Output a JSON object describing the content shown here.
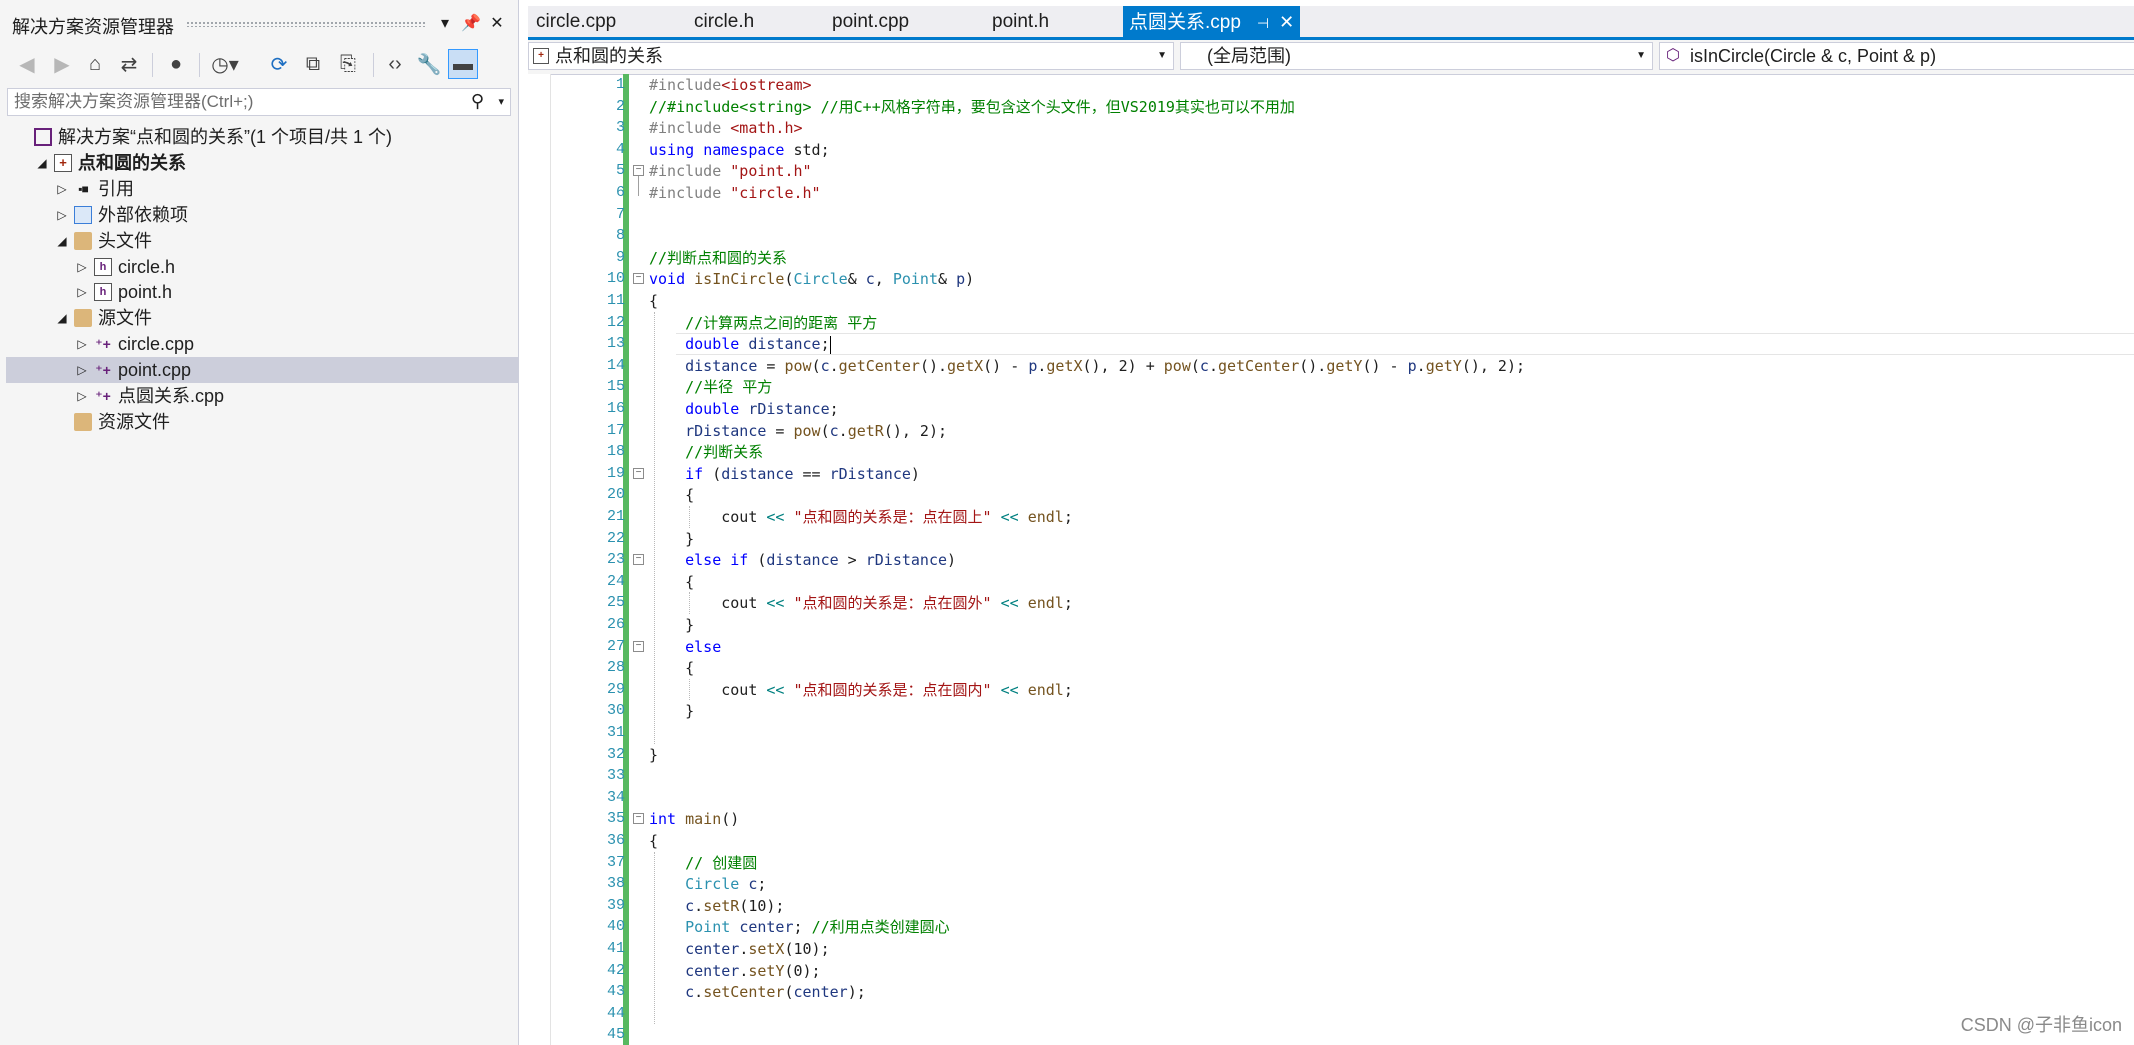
{
  "solution_explorer": {
    "title": "解决方案资源管理器",
    "title_buttons": [
      "dropdown-icon",
      "pin-icon",
      "close-icon"
    ],
    "toolbar_icons": [
      "back-icon",
      "forward-icon",
      "home-icon",
      "switch-views-icon",
      "globe-icon",
      "history-icon",
      "sync-icon",
      "collapse-all-icon",
      "show-all-files-icon",
      "view-code-icon",
      "properties-icon",
      "preview-icon"
    ],
    "search_placeholder": "搜索解决方案资源管理器(Ctrl+;)",
    "tree": [
      {
        "label": "解决方案“点和圆的关系”(1 个项目/共 1 个)",
        "icon": "solution-icon",
        "level": 0,
        "expander": ""
      },
      {
        "label": "点和圆的关系",
        "icon": "project-icon",
        "level": 1,
        "expander": "expanded",
        "bold": true
      },
      {
        "label": "引用",
        "icon": "references-icon",
        "level": 2,
        "expander": "collapsed"
      },
      {
        "label": "外部依赖项",
        "icon": "external-deps-icon",
        "level": 2,
        "expander": "collapsed"
      },
      {
        "label": "头文件",
        "icon": "folder-icon",
        "level": 2,
        "expander": "expanded"
      },
      {
        "label": "circle.h",
        "icon": "header-file-icon",
        "level": 3,
        "expander": "collapsed"
      },
      {
        "label": "point.h",
        "icon": "header-file-icon",
        "level": 3,
        "expander": "collapsed"
      },
      {
        "label": "源文件",
        "icon": "folder-icon",
        "level": 2,
        "expander": "expanded"
      },
      {
        "label": "circle.cpp",
        "icon": "cpp-file-icon",
        "level": 3,
        "expander": "collapsed"
      },
      {
        "label": "point.cpp",
        "icon": "cpp-file-icon",
        "level": 3,
        "expander": "collapsed",
        "selected": true
      },
      {
        "label": "点圆关系.cpp",
        "icon": "cpp-file-icon",
        "level": 3,
        "expander": "collapsed"
      },
      {
        "label": "资源文件",
        "icon": "folder-icon",
        "level": 2,
        "expander": ""
      }
    ]
  },
  "editor": {
    "tabs": [
      {
        "label": "circle.cpp"
      },
      {
        "label": "circle.h"
      },
      {
        "label": "point.cpp"
      },
      {
        "label": "point.h"
      },
      {
        "label": "点圆关系.cpp",
        "active": true
      }
    ],
    "nav": {
      "project": "点和圆的关系",
      "scope": "(全局范围)",
      "member": "isInCircle(Circle & c, Point & p)"
    },
    "current_line": 13,
    "lines": [
      {
        "n": 1,
        "fold": "",
        "tokens": [
          [
            "p",
            "#include"
          ],
          [
            "s",
            "<iostream>"
          ]
        ]
      },
      {
        "n": 2,
        "fold": "",
        "tokens": [
          [
            "c",
            "//#include<string> //用C++风格字符串，要包含这个头文件，但VS2019其实也可以不用加"
          ]
        ]
      },
      {
        "n": 3,
        "fold": "",
        "tokens": [
          [
            "p",
            "#include "
          ],
          [
            "s",
            "<math.h>"
          ]
        ]
      },
      {
        "n": 4,
        "fold": "",
        "tokens": [
          [
            "k",
            "using"
          ],
          [
            "",
            " "
          ],
          [
            "k",
            "namespace"
          ],
          [
            "",
            " std;"
          ]
        ]
      },
      {
        "n": 5,
        "fold": "minus",
        "tokens": [
          [
            "p",
            "#include "
          ],
          [
            "s",
            "\"point.h\""
          ]
        ]
      },
      {
        "n": 6,
        "fold": "",
        "tokens": [
          [
            "p",
            "#include "
          ],
          [
            "s",
            "\"circle.h\""
          ]
        ]
      },
      {
        "n": 7,
        "fold": "",
        "tokens": []
      },
      {
        "n": 8,
        "fold": "",
        "tokens": []
      },
      {
        "n": 9,
        "fold": "",
        "tokens": [
          [
            "c",
            "//判断点和圆的关系"
          ]
        ]
      },
      {
        "n": 10,
        "fold": "minus",
        "tokens": [
          [
            "k",
            "void"
          ],
          [
            "",
            " "
          ],
          [
            "f",
            "isInCircle"
          ],
          [
            "",
            "("
          ],
          [
            "t",
            "Circle"
          ],
          [
            "",
            "& "
          ],
          [
            "v",
            "c"
          ],
          [
            "",
            ", "
          ],
          [
            "t",
            "Point"
          ],
          [
            "",
            "& "
          ],
          [
            "v",
            "p"
          ],
          [
            "",
            ")"
          ]
        ]
      },
      {
        "n": 11,
        "fold": "",
        "tokens": [
          [
            "",
            "{"
          ]
        ]
      },
      {
        "n": 12,
        "fold": "",
        "tokens": [
          [
            "",
            "    "
          ],
          [
            "c",
            "//计算两点之间的距离 平方"
          ]
        ]
      },
      {
        "n": 13,
        "fold": "",
        "tokens": [
          [
            "",
            "    "
          ],
          [
            "k",
            "double"
          ],
          [
            "",
            " "
          ],
          [
            "v",
            "distance"
          ],
          [
            "",
            ";"
          ]
        ]
      },
      {
        "n": 14,
        "fold": "",
        "tokens": [
          [
            "",
            "    "
          ],
          [
            "v",
            "distance"
          ],
          [
            "",
            " = "
          ],
          [
            "f",
            "pow"
          ],
          [
            "",
            "("
          ],
          [
            "v",
            "c"
          ],
          [
            "",
            "."
          ],
          [
            "f",
            "getCenter"
          ],
          [
            "",
            "()."
          ],
          [
            "f",
            "getX"
          ],
          [
            "",
            "() - "
          ],
          [
            "v",
            "p"
          ],
          [
            "",
            "."
          ],
          [
            "f",
            "getX"
          ],
          [
            "",
            "(), 2) + "
          ],
          [
            "f",
            "pow"
          ],
          [
            "",
            "("
          ],
          [
            "v",
            "c"
          ],
          [
            "",
            "."
          ],
          [
            "f",
            "getCenter"
          ],
          [
            "",
            "()."
          ],
          [
            "f",
            "getY"
          ],
          [
            "",
            "() - "
          ],
          [
            "v",
            "p"
          ],
          [
            "",
            "."
          ],
          [
            "f",
            "getY"
          ],
          [
            "",
            "(), 2);"
          ]
        ]
      },
      {
        "n": 15,
        "fold": "",
        "tokens": [
          [
            "",
            "    "
          ],
          [
            "c",
            "//半径 平方"
          ]
        ]
      },
      {
        "n": 16,
        "fold": "",
        "tokens": [
          [
            "",
            "    "
          ],
          [
            "k",
            "double"
          ],
          [
            "",
            " "
          ],
          [
            "v",
            "rDistance"
          ],
          [
            "",
            ";"
          ]
        ]
      },
      {
        "n": 17,
        "fold": "",
        "tokens": [
          [
            "",
            "    "
          ],
          [
            "v",
            "rDistance"
          ],
          [
            "",
            " = "
          ],
          [
            "f",
            "pow"
          ],
          [
            "",
            "("
          ],
          [
            "v",
            "c"
          ],
          [
            "",
            "."
          ],
          [
            "f",
            "getR"
          ],
          [
            "",
            "(), 2);"
          ]
        ]
      },
      {
        "n": 18,
        "fold": "",
        "tokens": [
          [
            "",
            "    "
          ],
          [
            "c",
            "//判断关系"
          ]
        ]
      },
      {
        "n": 19,
        "fold": "minus",
        "tokens": [
          [
            "",
            "    "
          ],
          [
            "k",
            "if"
          ],
          [
            "",
            " ("
          ],
          [
            "v",
            "distance"
          ],
          [
            "",
            " == "
          ],
          [
            "v",
            "rDistance"
          ],
          [
            "",
            ")"
          ]
        ]
      },
      {
        "n": 20,
        "fold": "",
        "tokens": [
          [
            "",
            "    {"
          ]
        ]
      },
      {
        "n": 21,
        "fold": "",
        "tokens": [
          [
            "",
            "        cout "
          ],
          [
            "o",
            "<<"
          ],
          [
            "",
            " "
          ],
          [
            "s",
            "\"点和圆的关系是：点在圆上\""
          ],
          [
            "",
            " "
          ],
          [
            "o",
            "<<"
          ],
          [
            "",
            " "
          ],
          [
            "f",
            "endl"
          ],
          [
            "",
            ";"
          ]
        ]
      },
      {
        "n": 22,
        "fold": "",
        "tokens": [
          [
            "",
            "    }"
          ]
        ]
      },
      {
        "n": 23,
        "fold": "minus",
        "tokens": [
          [
            "",
            "    "
          ],
          [
            "k",
            "else if"
          ],
          [
            "",
            " ("
          ],
          [
            "v",
            "distance"
          ],
          [
            "",
            " > "
          ],
          [
            "v",
            "rDistance"
          ],
          [
            "",
            ")"
          ]
        ]
      },
      {
        "n": 24,
        "fold": "",
        "tokens": [
          [
            "",
            "    {"
          ]
        ]
      },
      {
        "n": 25,
        "fold": "",
        "tokens": [
          [
            "",
            "        cout "
          ],
          [
            "o",
            "<<"
          ],
          [
            "",
            " "
          ],
          [
            "s",
            "\"点和圆的关系是：点在圆外\""
          ],
          [
            "",
            " "
          ],
          [
            "o",
            "<<"
          ],
          [
            "",
            " "
          ],
          [
            "f",
            "endl"
          ],
          [
            "",
            ";"
          ]
        ]
      },
      {
        "n": 26,
        "fold": "",
        "tokens": [
          [
            "",
            "    }"
          ]
        ]
      },
      {
        "n": 27,
        "fold": "minus",
        "tokens": [
          [
            "",
            "    "
          ],
          [
            "k",
            "else"
          ]
        ]
      },
      {
        "n": 28,
        "fold": "",
        "tokens": [
          [
            "",
            "    {"
          ]
        ]
      },
      {
        "n": 29,
        "fold": "",
        "tokens": [
          [
            "",
            "        cout "
          ],
          [
            "o",
            "<<"
          ],
          [
            "",
            " "
          ],
          [
            "s",
            "\"点和圆的关系是：点在圆内\""
          ],
          [
            "",
            " "
          ],
          [
            "o",
            "<<"
          ],
          [
            "",
            " "
          ],
          [
            "f",
            "endl"
          ],
          [
            "",
            ";"
          ]
        ]
      },
      {
        "n": 30,
        "fold": "",
        "tokens": [
          [
            "",
            "    }"
          ]
        ]
      },
      {
        "n": 31,
        "fold": "",
        "tokens": []
      },
      {
        "n": 32,
        "fold": "",
        "tokens": [
          [
            "",
            "}"
          ]
        ]
      },
      {
        "n": 33,
        "fold": "",
        "tokens": []
      },
      {
        "n": 34,
        "fold": "",
        "tokens": []
      },
      {
        "n": 35,
        "fold": "minus",
        "tokens": [
          [
            "k",
            "int"
          ],
          [
            "",
            " "
          ],
          [
            "f",
            "main"
          ],
          [
            "",
            "()"
          ]
        ]
      },
      {
        "n": 36,
        "fold": "",
        "tokens": [
          [
            "",
            "{"
          ]
        ]
      },
      {
        "n": 37,
        "fold": "",
        "tokens": [
          [
            "",
            "    "
          ],
          [
            "c",
            "// 创建圆"
          ]
        ]
      },
      {
        "n": 38,
        "fold": "",
        "tokens": [
          [
            "",
            "    "
          ],
          [
            "t",
            "Circle"
          ],
          [
            "",
            " "
          ],
          [
            "v",
            "c"
          ],
          [
            "",
            ";"
          ]
        ]
      },
      {
        "n": 39,
        "fold": "",
        "tokens": [
          [
            "",
            "    "
          ],
          [
            "v",
            "c"
          ],
          [
            "",
            "."
          ],
          [
            "f",
            "setR"
          ],
          [
            "",
            "(10);"
          ]
        ]
      },
      {
        "n": 40,
        "fold": "",
        "tokens": [
          [
            "",
            "    "
          ],
          [
            "t",
            "Point"
          ],
          [
            "",
            " "
          ],
          [
            "v",
            "center"
          ],
          [
            "",
            "; "
          ],
          [
            "c",
            "//利用点类创建圆心"
          ]
        ]
      },
      {
        "n": 41,
        "fold": "",
        "tokens": [
          [
            "",
            "    "
          ],
          [
            "v",
            "center"
          ],
          [
            "",
            "."
          ],
          [
            "f",
            "setX"
          ],
          [
            "",
            "(10);"
          ]
        ]
      },
      {
        "n": 42,
        "fold": "",
        "tokens": [
          [
            "",
            "    "
          ],
          [
            "v",
            "center"
          ],
          [
            "",
            "."
          ],
          [
            "f",
            "setY"
          ],
          [
            "",
            "(0);"
          ]
        ]
      },
      {
        "n": 43,
        "fold": "",
        "tokens": [
          [
            "",
            "    "
          ],
          [
            "v",
            "c"
          ],
          [
            "",
            "."
          ],
          [
            "f",
            "setCenter"
          ],
          [
            "",
            "("
          ],
          [
            "v",
            "center"
          ],
          [
            "",
            ");"
          ]
        ]
      },
      {
        "n": 44,
        "fold": "",
        "tokens": []
      },
      {
        "n": 45,
        "fold": "",
        "tokens": []
      }
    ]
  },
  "watermark": "CSDN @子非鱼icon"
}
